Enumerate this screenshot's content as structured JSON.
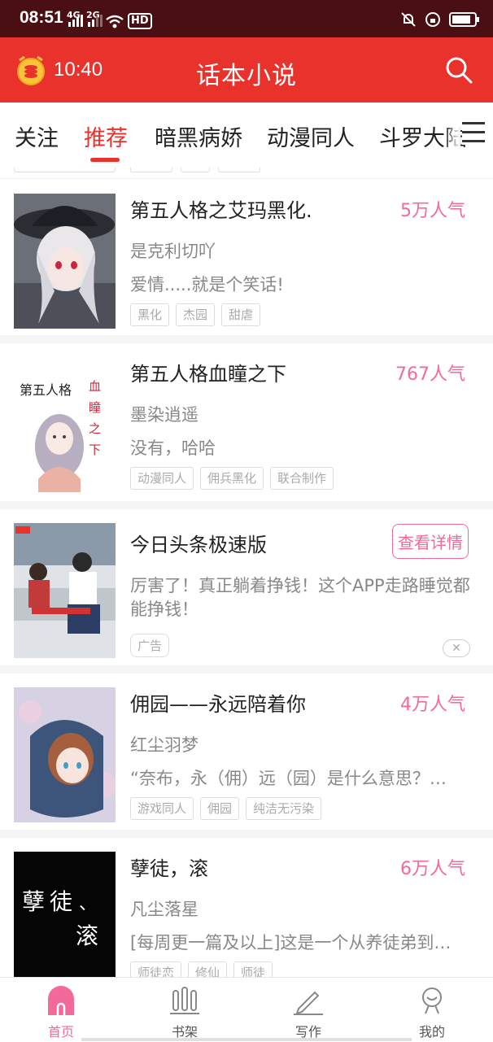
{
  "status_bar": {
    "time": "08:51",
    "signal1": "4G",
    "signal2": "2G",
    "hd": "HD",
    "icons": [
      "bell-off-icon",
      "lock-rotation-icon",
      "battery-icon"
    ]
  },
  "app_bar": {
    "timer": "10:40",
    "title": "话本小说",
    "icons": [
      "coin-alarm-icon",
      "search-icon"
    ]
  },
  "tabs": [
    {
      "label": "关注",
      "active": false
    },
    {
      "label": "推荐",
      "active": true
    },
    {
      "label": "暗黑病娇",
      "active": false
    },
    {
      "label": "动漫同人",
      "active": false
    },
    {
      "label": "斗罗大陆",
      "active": false
    }
  ],
  "books": [
    {
      "title": "第五人格之艾玛黑化.",
      "popularity": "5万人气",
      "author": "是克利切吖",
      "description": "爱情.....就是个笑话!",
      "tags": [
        "黑化",
        "杰园",
        "甜虐"
      ]
    },
    {
      "title": "第五人格血瞳之下",
      "popularity": "767人气",
      "author": "墨染逍遥",
      "description": "没有，哈哈",
      "tags": [
        "动漫同人",
        "佣兵黑化",
        "联合制作"
      ],
      "cover_text": {
        "left": "第五人格",
        "right": [
          "血",
          "瞳",
          "之",
          "下"
        ]
      }
    },
    {
      "title": "佣园——永远陪着你",
      "popularity": "4万人气",
      "author": "红尘羽梦",
      "description": "“奈布，永（佣）远（园）是什么意思？…",
      "tags": [
        "游戏同人",
        "佣园",
        "纯洁无污染"
      ]
    },
    {
      "title": "孽徒，滚",
      "popularity": "6万人气",
      "author": "凡尘落星",
      "description": "[每周更一篇及以上]这是一个从养徒弟到…",
      "tags": [
        "师徒恋",
        "修仙",
        "师徒"
      ],
      "cover_text": [
        "孽",
        "徒",
        "、",
        "滚"
      ]
    }
  ],
  "ad": {
    "title": "今日头条极速版",
    "button": "查看详情",
    "description": "厉害了！真正躺着挣钱！这个APP走路睡觉都能挣钱！",
    "tag": "广告",
    "close": "✕"
  },
  "bottom_nav": [
    {
      "label": "首页",
      "icon": "home-icon",
      "active": true
    },
    {
      "label": "书架",
      "icon": "bookshelf-icon",
      "active": false
    },
    {
      "label": "写作",
      "icon": "pen-icon",
      "active": false
    },
    {
      "label": "我的",
      "icon": "profile-icon",
      "active": false
    }
  ],
  "colors": {
    "status_bar": "#4a0f12",
    "accent": "#e8322b",
    "popularity": "#f16a9a"
  }
}
